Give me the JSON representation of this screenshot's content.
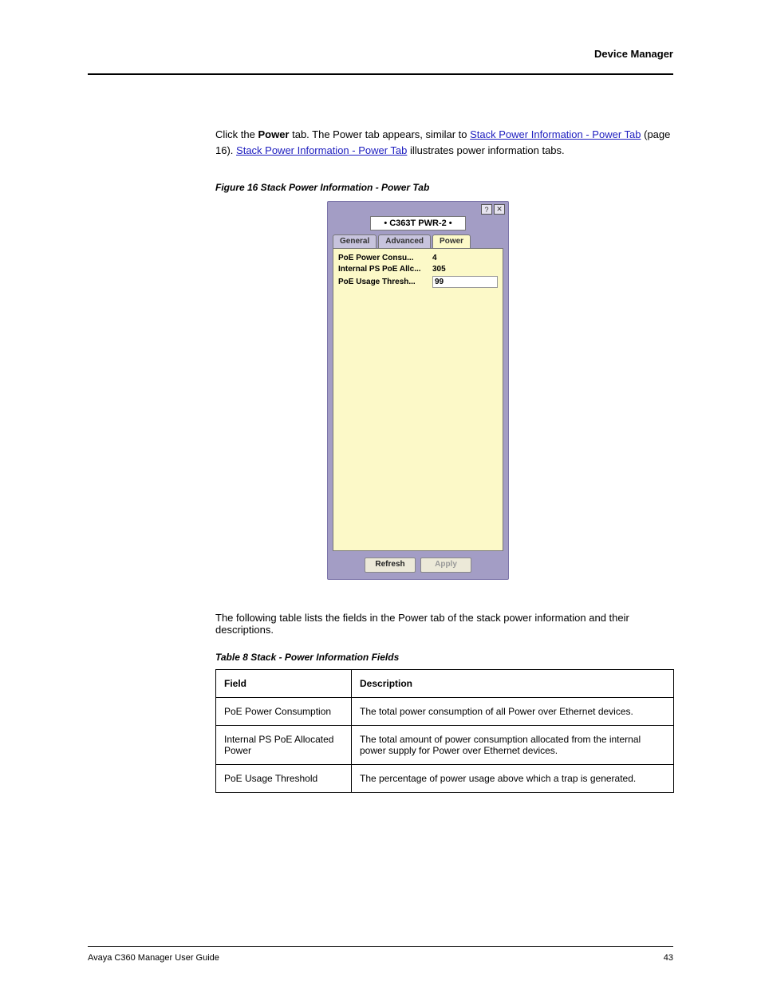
{
  "header": {
    "section": "Device Manager"
  },
  "intro": {
    "prefix": "Click the ",
    "bold": "Power",
    "mid": " tab. The Power tab appears, similar to ",
    "link1": "Stack Power Information - Power Tab",
    "after": " (page 16)",
    "link2": "Stack Power Information - Power Tab",
    "tail": " illustrates power information tabs."
  },
  "figure": {
    "caption": "Figure 16   Stack Power Information - Power Tab"
  },
  "dialog": {
    "title": "• C363T PWR-2 •",
    "tabs": [
      "General",
      "Advanced",
      "Power"
    ],
    "fields": [
      {
        "label": "PoE Power Consu...",
        "value": "4"
      },
      {
        "label": "Internal PS PoE Allc...",
        "value": "305"
      },
      {
        "label": "PoE Usage Thresh...",
        "value": "99",
        "input": true
      }
    ],
    "buttons": {
      "refresh": "Refresh",
      "apply": "Apply"
    }
  },
  "tableIntro": "The following table lists the fields in the Power tab of the stack power information and their descriptions.",
  "tableCaption": "Table 8   Stack - Power Information Fields",
  "table": {
    "head": [
      "Field",
      "Description"
    ],
    "rows": [
      {
        "f": "PoE Power Consumption",
        "d": "The total power consumption of all Power over Ethernet devices."
      },
      {
        "f": "Internal PS PoE Allocated Power",
        "d": "The total amount of power consumption allocated from the internal power supply for Power over Ethernet devices."
      },
      {
        "f": "PoE Usage Threshold",
        "d": "The percentage of power usage above which a trap is generated."
      }
    ]
  },
  "footer": {
    "left": "Avaya C360 Manager User Guide",
    "right": "43"
  }
}
